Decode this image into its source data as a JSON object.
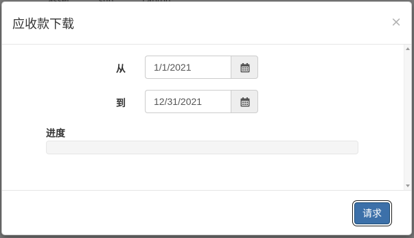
{
  "background": {
    "columns": [
      "asset",
      "sub",
      "Laptop"
    ]
  },
  "dialog": {
    "title": "应收款下载",
    "close_label": "×"
  },
  "form": {
    "from": {
      "label": "从",
      "value": "1/1/2021",
      "icon": "calendar-icon"
    },
    "to": {
      "label": "到",
      "value": "12/31/2021",
      "icon": "calendar-icon"
    },
    "progress": {
      "label": "进度",
      "value": 0
    }
  },
  "footer": {
    "request_label": "请求"
  },
  "colors": {
    "primary_button": "#3c70a9",
    "progress_fill": "#337ab7",
    "progress_track": "#f5f5f5"
  }
}
